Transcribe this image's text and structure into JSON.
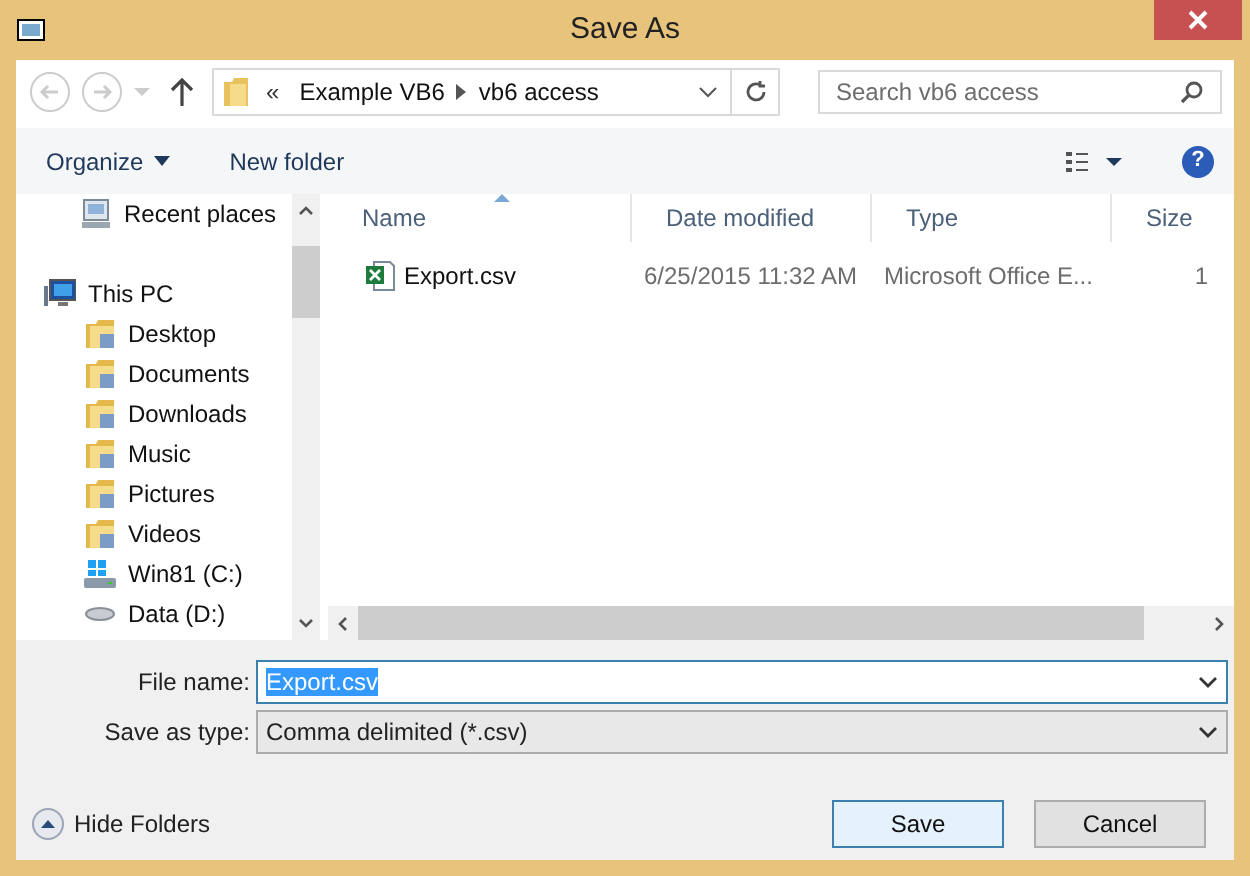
{
  "window": {
    "title": "Save As"
  },
  "address_bar": {
    "crumbs": [
      "Example VB6",
      "vb6 access"
    ],
    "overflow": "«"
  },
  "search": {
    "placeholder": "Search vb6 access"
  },
  "toolbar": {
    "organize": "Organize",
    "new_folder": "New folder",
    "help": "?"
  },
  "navigation": [
    {
      "label": "Recent places",
      "kind": "recent"
    },
    {
      "label": "This PC",
      "kind": "pc",
      "children": [
        {
          "label": "Desktop",
          "kind": "folder"
        },
        {
          "label": "Documents",
          "kind": "folder"
        },
        {
          "label": "Downloads",
          "kind": "folder"
        },
        {
          "label": "Music",
          "kind": "folder"
        },
        {
          "label": "Pictures",
          "kind": "folder"
        },
        {
          "label": "Videos",
          "kind": "folder"
        },
        {
          "label": "Win81 (C:)",
          "kind": "drive"
        },
        {
          "label": "Data (D:)",
          "kind": "disk"
        }
      ]
    }
  ],
  "columns": [
    "Name",
    "Date modified",
    "Type",
    "Size"
  ],
  "files": [
    {
      "name": "Export.csv",
      "date_modified": "6/25/2015 11:32 AM",
      "type": "Microsoft Office E...",
      "size": "1",
      "selected": false
    }
  ],
  "file_name": {
    "label": "File name:",
    "value": "Export.csv",
    "text_selected": true
  },
  "save_as_type": {
    "label": "Save as type:",
    "value": "Comma delimited (*.csv)"
  },
  "hide_folders": "Hide Folders",
  "buttons": [
    {
      "label": "Save",
      "default": true
    },
    {
      "label": "Cancel",
      "default": false
    }
  ]
}
